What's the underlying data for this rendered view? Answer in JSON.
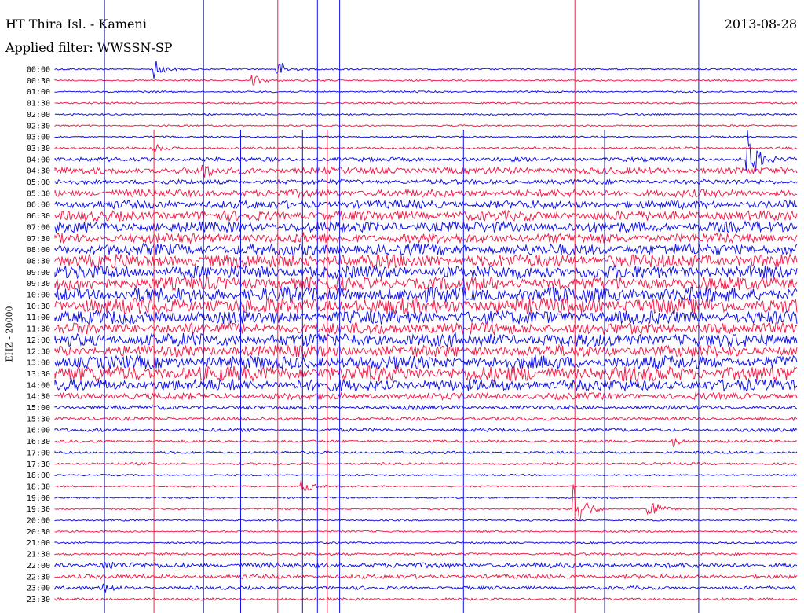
{
  "header": {
    "station": "HT Thira Isl. - Kameni",
    "date": "2013-08-28",
    "filter": "Applied filter: WWSSN-SP"
  },
  "colors": {
    "a": "#1414e6",
    "b": "#f0204c"
  },
  "chart_data": {
    "type": "line",
    "title": "HT Thira Isl. - Kameni",
    "ylabel": "EHZ - 20000",
    "grid": false,
    "rows": [
      "00:00",
      "00:30",
      "01:00",
      "01:30",
      "02:00",
      "02:30",
      "03:00",
      "03:30",
      "04:00",
      "04:30",
      "05:00",
      "05:30",
      "06:00",
      "06:30",
      "07:00",
      "07:30",
      "08:00",
      "08:30",
      "09:00",
      "09:30",
      "10:00",
      "10:30",
      "11:00",
      "11:30",
      "12:00",
      "12:30",
      "13:00",
      "13:30",
      "14:00",
      "14:30",
      "15:00",
      "15:30",
      "16:00",
      "16:30",
      "17:00",
      "17:30",
      "18:00",
      "18:30",
      "19:00",
      "19:30",
      "20:00",
      "20:30",
      "21:00",
      "21:30",
      "22:00",
      "22:30",
      "23:00",
      "23:30"
    ],
    "row_colors": [
      "a",
      "b",
      "a",
      "b",
      "a",
      "b",
      "a",
      "b",
      "a",
      "b",
      "a",
      "b",
      "a",
      "b",
      "a",
      "b",
      "a",
      "b",
      "a",
      "b",
      "a",
      "b",
      "a",
      "b",
      "a",
      "b",
      "a",
      "b",
      "a",
      "b",
      "a",
      "b",
      "a",
      "b",
      "a",
      "b",
      "a",
      "b",
      "a",
      "b",
      "a",
      "b",
      "a",
      "b",
      "a",
      "b",
      "a",
      "b"
    ],
    "noise_level": [
      1,
      1,
      1,
      1,
      1,
      1,
      1,
      1.5,
      2.5,
      4,
      3,
      4.5,
      5,
      6,
      6.5,
      6,
      7,
      8,
      8,
      8,
      9,
      9.5,
      8,
      7,
      8,
      7,
      8,
      9,
      7,
      4,
      2.5,
      2,
      2,
      1.5,
      1.5,
      1.5,
      1,
      1,
      1,
      1,
      1,
      1,
      1,
      1.5,
      3,
      2.5,
      2,
      1.5
    ],
    "events": [
      {
        "row": "00:00",
        "minute": 4,
        "amp": 14
      },
      {
        "row": "00:00",
        "minute": 9,
        "amp": 12
      },
      {
        "row": "00:30",
        "minute": 8,
        "amp": 8
      },
      {
        "row": "03:30",
        "minute": 4,
        "amp": 5
      },
      {
        "row": "04:00",
        "minute": 28,
        "amp": 35
      },
      {
        "row": "04:30",
        "minute": 6,
        "amp": 6
      },
      {
        "row": "16:30",
        "minute": 25,
        "amp": 6
      },
      {
        "row": "18:30",
        "minute": 10,
        "amp": 10
      },
      {
        "row": "19:30",
        "minute": 21,
        "amp": 40
      },
      {
        "row": "19:30",
        "minute": 24,
        "amp": 18
      },
      {
        "row": "22:00",
        "minute": 2,
        "amp": 7
      },
      {
        "row": "23:00",
        "minute": 2,
        "amp": 6
      }
    ],
    "spikes_minute": [
      2,
      4,
      6,
      7.5,
      9,
      10,
      10.6,
      11,
      11.5,
      16.5,
      21,
      22.2,
      26
    ]
  }
}
